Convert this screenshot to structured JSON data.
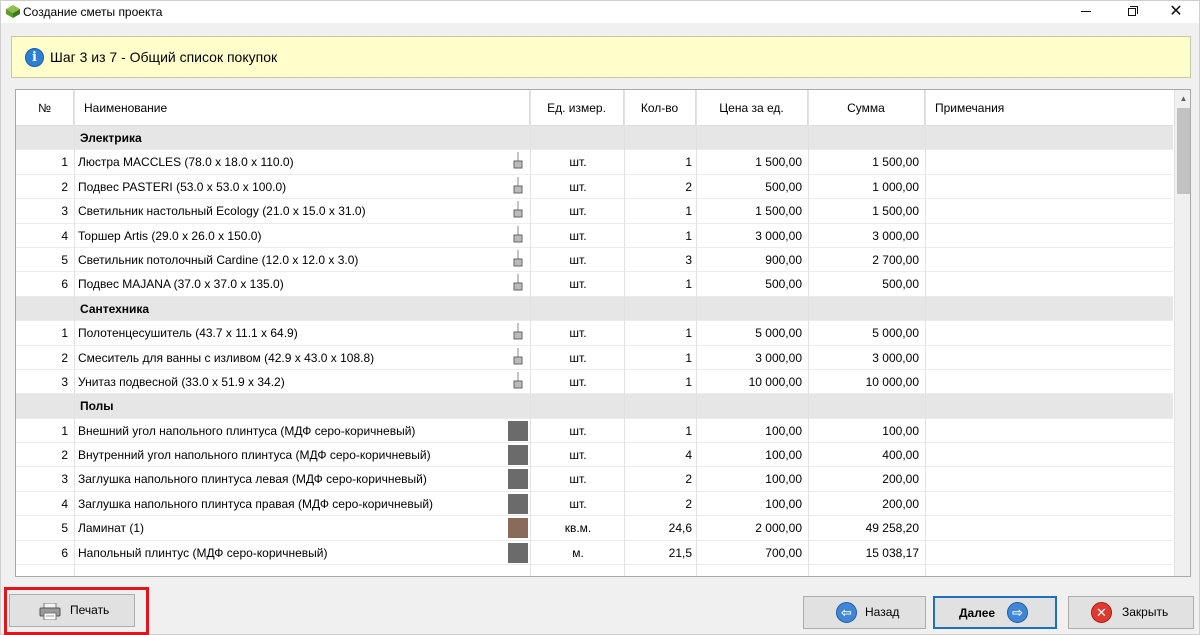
{
  "window": {
    "title": "Создание сметы проекта"
  },
  "step": {
    "text": "Шаг 3 из 7 - Общий список покупок"
  },
  "columns": {
    "num": "№",
    "name": "Наименование",
    "unit": "Ед. измер.",
    "qty": "Кол-во",
    "price": "Цена за ед.",
    "sum": "Сумма",
    "note": "Примечания"
  },
  "groups": [
    {
      "title": "Электрика",
      "items": [
        {
          "num": "1",
          "name": "Люстра MACCLES (78.0 x 18.0 x 110.0)",
          "thumb": "chandelier-icon",
          "unit": "шт.",
          "qty": "1",
          "price": "1 500,00",
          "sum": "1 500,00"
        },
        {
          "num": "2",
          "name": "Подвес PASTERI (53.0 x 53.0 x 100.0)",
          "thumb": "pendant-icon",
          "unit": "шт.",
          "qty": "2",
          "price": "500,00",
          "sum": "1 000,00"
        },
        {
          "num": "3",
          "name": "Светильник настольный Ecology (21.0 x 15.0 x 31.0)",
          "thumb": "table-lamp-icon",
          "unit": "шт.",
          "qty": "1",
          "price": "1 500,00",
          "sum": "1 500,00"
        },
        {
          "num": "4",
          "name": "Торшер Artis (29.0 x 26.0 x 150.0)",
          "thumb": "floor-lamp-icon",
          "unit": "шт.",
          "qty": "1",
          "price": "3 000,00",
          "sum": "3 000,00"
        },
        {
          "num": "5",
          "name": "Светильник потолочный Cardine (12.0 x 12.0 x 3.0)",
          "thumb": "ceiling-light-icon",
          "unit": "шт.",
          "qty": "3",
          "price": "900,00",
          "sum": "2 700,00"
        },
        {
          "num": "6",
          "name": "Подвес MAJANA (37.0 x 37.0 x 135.0)",
          "thumb": "pendant-icon",
          "unit": "шт.",
          "qty": "1",
          "price": "500,00",
          "sum": "500,00"
        }
      ]
    },
    {
      "title": "Сантехника",
      "items": [
        {
          "num": "1",
          "name": "Полотенцесушитель (43.7 x 11.1 x 64.9)",
          "thumb": "towel-rail-icon",
          "unit": "шт.",
          "qty": "1",
          "price": "5 000,00",
          "sum": "5 000,00"
        },
        {
          "num": "2",
          "name": "Смеситель для ванны с изливом (42.9 x 43.0 x 108.8)",
          "thumb": "faucet-icon",
          "unit": "шт.",
          "qty": "1",
          "price": "3 000,00",
          "sum": "3 000,00"
        },
        {
          "num": "3",
          "name": "Унитаз подвесной (33.0 x 51.9 x 34.2)",
          "thumb": "toilet-icon",
          "unit": "шт.",
          "qty": "1",
          "price": "10 000,00",
          "sum": "10 000,00"
        }
      ]
    },
    {
      "title": "Полы",
      "items": [
        {
          "num": "1",
          "name": "Внешний угол напольного плинтуса (МДФ серо-коричневый)",
          "thumb": "swatch-gray",
          "unit": "шт.",
          "qty": "1",
          "price": "100,00",
          "sum": "100,00"
        },
        {
          "num": "2",
          "name": "Внутренний угол напольного плинтуса (МДФ серо-коричневый)",
          "thumb": "swatch-gray",
          "unit": "шт.",
          "qty": "4",
          "price": "100,00",
          "sum": "400,00"
        },
        {
          "num": "3",
          "name": "Заглушка напольного плинтуса левая (МДФ серо-коричневый)",
          "thumb": "swatch-gray",
          "unit": "шт.",
          "qty": "2",
          "price": "100,00",
          "sum": "200,00"
        },
        {
          "num": "4",
          "name": "Заглушка напольного плинтуса правая (МДФ серо-коричневый)",
          "thumb": "swatch-gray",
          "unit": "шт.",
          "qty": "2",
          "price": "100,00",
          "sum": "200,00"
        },
        {
          "num": "5",
          "name": "Ламинат (1)",
          "thumb": "swatch-laminate",
          "unit": "кв.м.",
          "qty": "24,6",
          "price": "2 000,00",
          "sum": "49 258,20"
        },
        {
          "num": "6",
          "name": "Напольный плинтус (МДФ серо-коричневый)",
          "thumb": "swatch-gray",
          "unit": "м.",
          "qty": "21,5",
          "price": "700,00",
          "sum": "15 038,17"
        }
      ]
    }
  ],
  "buttons": {
    "print": "Печать",
    "back": "Назад",
    "next": "Далее",
    "close": "Закрыть"
  },
  "colors": {
    "step_bg": "#ffffcc",
    "group_bg": "#e6e6e6",
    "highlight": "#e3151a",
    "accent": "#1f6fbf"
  }
}
